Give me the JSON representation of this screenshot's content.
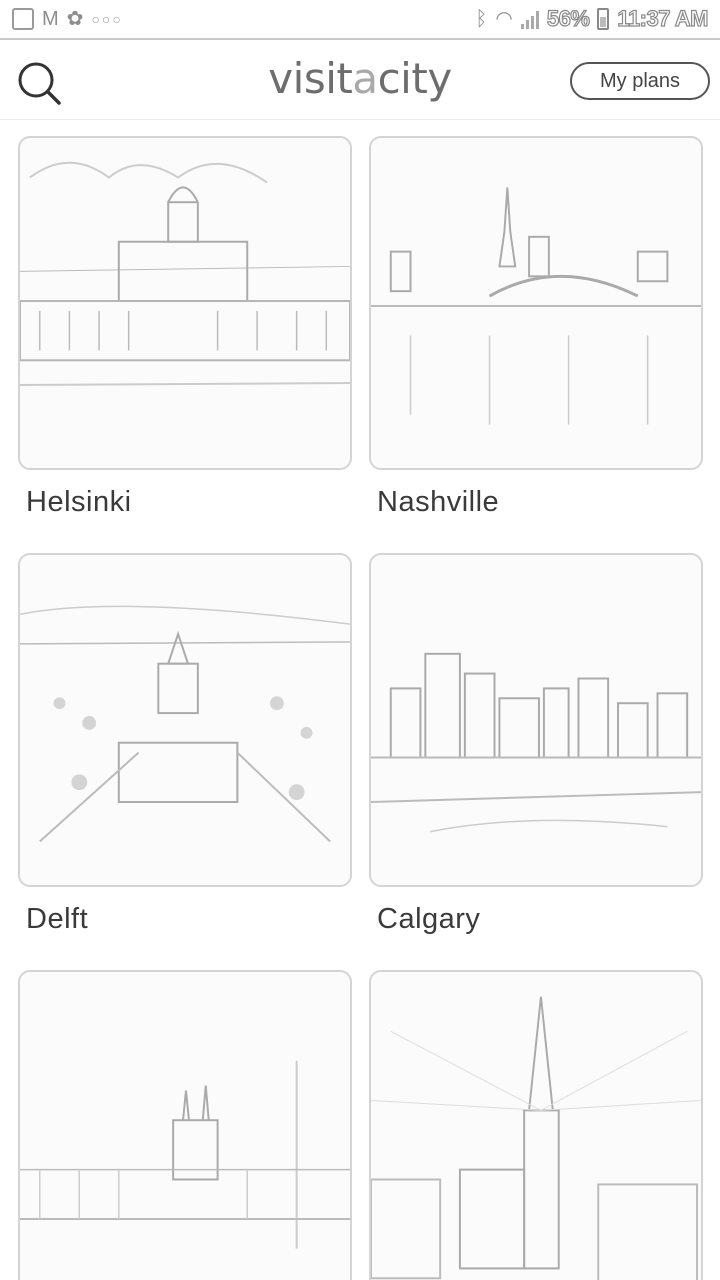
{
  "status_bar": {
    "left_icons": [
      "gallery-icon",
      "gmail-icon",
      "pinwheel-icon",
      "more-dots-icon"
    ],
    "right_icons": [
      "bluetooth-icon",
      "wifi-icon",
      "signal-icon",
      "battery-icon"
    ],
    "battery_percent": "56%",
    "time": "11:37 AM"
  },
  "header": {
    "brand_prefix": "visit",
    "brand_highlight": "a",
    "brand_suffix": "city",
    "my_plans_label": "My plans"
  },
  "cities": [
    {
      "name": "Helsinki"
    },
    {
      "name": "Nashville"
    },
    {
      "name": "Delft"
    },
    {
      "name": "Calgary"
    },
    {
      "name": ""
    },
    {
      "name": ""
    }
  ]
}
